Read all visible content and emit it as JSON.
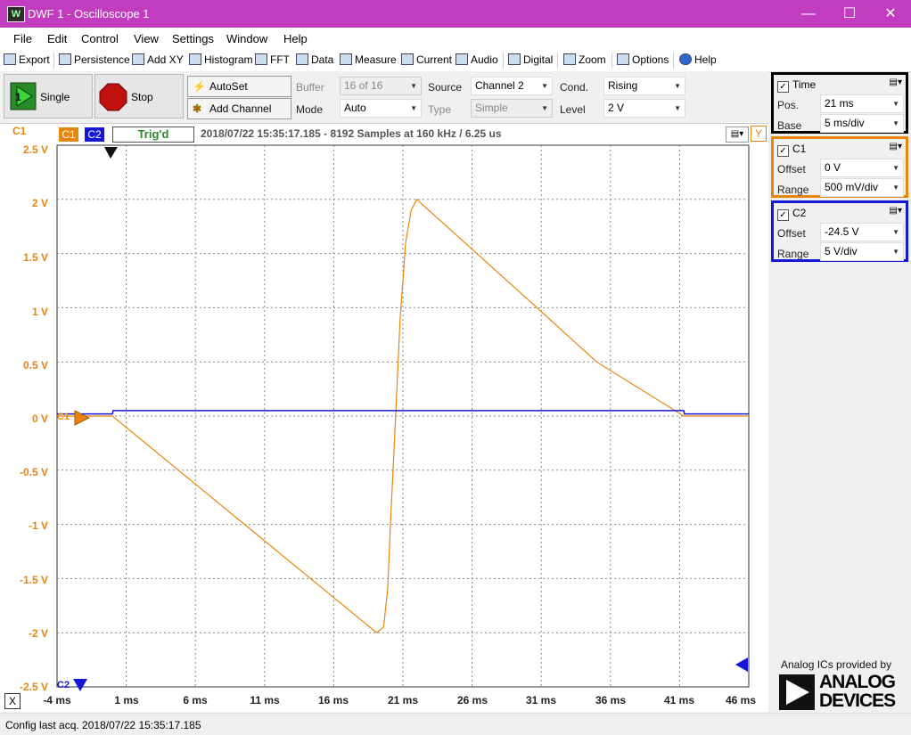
{
  "window": {
    "title": "DWF 1 - Oscilloscope 1",
    "app_icon_text": "W",
    "minimize": "—",
    "maximize": "☐",
    "close": "✕"
  },
  "menu": [
    "File",
    "Edit",
    "Control",
    "View",
    "Settings",
    "Window",
    "Help"
  ],
  "toolbar": [
    "Export",
    "Persistence",
    "Add XY",
    "Histogram",
    "FFT",
    "Data",
    "Measure",
    "Current",
    "Audio",
    "Digital",
    "Zoom",
    "Options",
    "Help"
  ],
  "controls": {
    "single_label": "Single",
    "stop_label": "Stop",
    "autoset_label": "AutoSet",
    "add_channel_label": "Add Channel",
    "buffer_label": "Buffer",
    "buffer_value": "16 of 16",
    "mode_label": "Mode",
    "mode_value": "Auto",
    "source_label": "Source",
    "source_value": "Channel 2",
    "type_label": "Type",
    "type_value": "Simple",
    "cond_label": "Cond.",
    "cond_value": "Rising",
    "level_label": "Level",
    "level_value": "2 V"
  },
  "plot_header": {
    "axis_channel": "C1",
    "c1_tab": "C1",
    "c2_tab": "C2",
    "trig_status": "Trig'd",
    "info": "2018/07/22  15:35:17.185 - 8192 Samples at 160 kHz / 6.25 us",
    "y_button": "Y",
    "x_button": "X",
    "c1_marker": "C1",
    "c2_marker": "C2"
  },
  "chart_data": {
    "type": "line",
    "xlim": [
      -4,
      46
    ],
    "ylim": [
      -2.5,
      2.5
    ],
    "x_ticks": [
      "-4 ms",
      "1 ms",
      "6 ms",
      "11 ms",
      "16 ms",
      "21 ms",
      "26 ms",
      "31 ms",
      "36 ms",
      "41 ms",
      "46 ms"
    ],
    "y_ticks": [
      "2.5 V",
      "2 V",
      "1.5 V",
      "1 V",
      "0.5 V",
      "0 V",
      "-0.5 V",
      "-1 V",
      "-1.5 V",
      "-2 V",
      "-2.5 V"
    ],
    "grid": true,
    "series": [
      {
        "name": "C1",
        "color": "#e8850c",
        "x": [
          -4,
          0,
          19.1,
          19.6,
          19.9,
          20.1,
          20.4,
          20.8,
          21.2,
          21.6,
          22.0,
          30,
          35,
          41.3,
          46
        ],
        "y": [
          0,
          0,
          -2.0,
          -1.95,
          -1.6,
          -1.0,
          -0.2,
          0.9,
          1.6,
          1.9,
          2.0,
          1.08,
          0.5,
          0,
          0
        ]
      },
      {
        "name": "C2",
        "color": "#1616d6",
        "x": [
          -4,
          0,
          0.05,
          41.3,
          41.35,
          46
        ],
        "y": [
          -24.3,
          -24.3,
          -24.0,
          -24.0,
          -24.3,
          -24.3
        ]
      }
    ]
  },
  "time_panel": {
    "title": "Time",
    "pos_label": "Pos.",
    "pos_value": "21 ms",
    "base_label": "Base",
    "base_value": "5 ms/div",
    "color": "#000000"
  },
  "c1_panel": {
    "title": "C1",
    "offset_label": "Offset",
    "offset_value": "0 V",
    "range_label": "Range",
    "range_value": "500 mV/div",
    "color": "#e8850c"
  },
  "c2_panel": {
    "title": "C2",
    "offset_label": "Offset",
    "offset_value": "-24.5 V",
    "range_label": "Range",
    "range_value": "5 V/div",
    "color": "#1616d6"
  },
  "brand": {
    "tagline": "Analog ICs provided by",
    "name_line1": "ANALOG",
    "name_line2": "DEVICES"
  },
  "status": {
    "text": "Config last acq. 2018/07/22  15:35:17.185"
  }
}
